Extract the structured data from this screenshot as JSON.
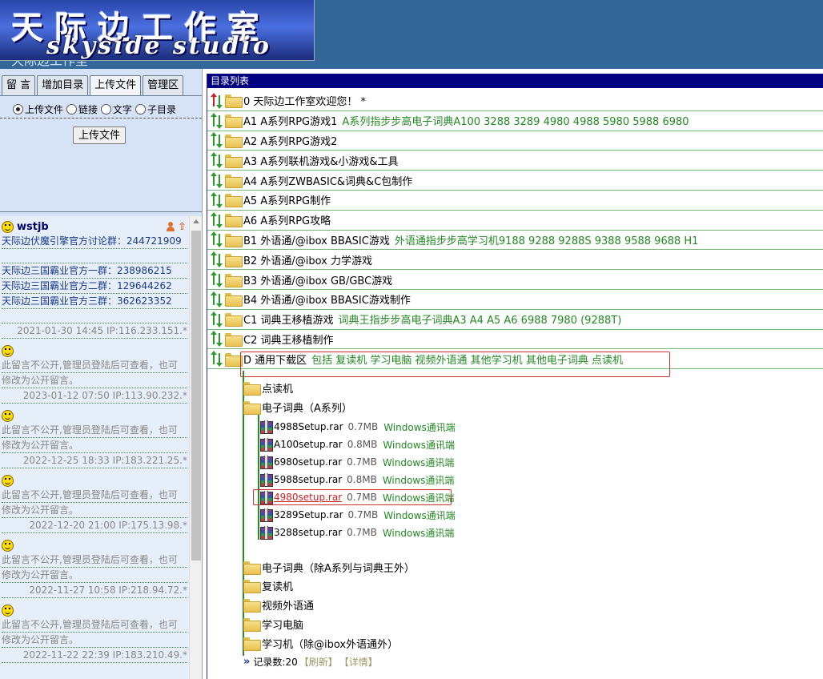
{
  "header": {
    "logo_cn": "天际边工作室",
    "logo_en": "skyside studio",
    "subtitle": "天际边工作室"
  },
  "left": {
    "tabs": [
      "留 言",
      "增加目录",
      "上传文件",
      "管理区"
    ],
    "active_tab": "上传文件",
    "radios": [
      {
        "label": "上传文件",
        "checked": true
      },
      {
        "label": "链接",
        "checked": false
      },
      {
        "label": "文字",
        "checked": false
      },
      {
        "label": "子目录",
        "checked": false
      }
    ],
    "upload_button": "上传文件",
    "guestbook": [
      {
        "user": "wstjb",
        "lines": [
          "天际边伏魔引擎官方讨论群：244721909",
          "",
          "天际边三国霸业官方一群：238986215",
          "天际边三国霸业官方二群：129644262",
          "天际边三国霸业官方三群：362623352",
          ""
        ],
        "meta": "2021-01-30 14:45 IP:116.233.151.*"
      },
      {
        "user": "",
        "lines": [
          "此留言不公开,管理员登陆后可查看，也可",
          "修改为公开留言。"
        ],
        "meta": "2023-01-12 07:50 IP:113.90.232.*"
      },
      {
        "user": "",
        "lines": [
          "此留言不公开,管理员登陆后可查看，也可",
          "修改为公开留言。"
        ],
        "meta": "2022-12-25 18:33 IP:183.221.25.*"
      },
      {
        "user": "",
        "lines": [
          "此留言不公开,管理员登陆后可查看，也可",
          "修改为公开留言。"
        ],
        "meta": "2022-12-20 21:00 IP:175.13.98.*"
      },
      {
        "user": "",
        "lines": [
          "此留言不公开,管理员登陆后可查看，也可",
          "修改为公开留言。"
        ],
        "meta": "2022-11-27 10:58 IP:218.94.72.*"
      },
      {
        "user": "",
        "lines": [
          "此留言不公开,管理员登陆后可查看，也可",
          "修改为公开留言。"
        ],
        "meta": "2022-11-22 22:39 IP:183.210.49.*"
      }
    ]
  },
  "right": {
    "title": "目录列表",
    "rows": [
      {
        "label": "0 天际边工作室欢迎您！ *",
        "desc": "",
        "red": true
      },
      {
        "label": "A1 A系列RPG游戏1",
        "desc": "A系列指步步高电子词典A100 3288 3289 4980 4988 5980 5988 6980",
        "red": false
      },
      {
        "label": "A2 A系列RPG游戏2",
        "desc": "",
        "red": false
      },
      {
        "label": "A3 A系列联机游戏&小游戏&工具",
        "desc": "",
        "red": false
      },
      {
        "label": "A4 A系列ZWBASIC&词典&C包制作",
        "desc": "",
        "red": false
      },
      {
        "label": "A5 A系列RPG制作",
        "desc": "",
        "red": false
      },
      {
        "label": "A6 A系列RPG攻略",
        "desc": "",
        "red": false
      },
      {
        "label": "B1 外语通/@ibox BBASIC游戏",
        "desc": "外语通指步步高学习机9188 9288 9288S 9388 9588 9688 H1",
        "red": false
      },
      {
        "label": "B2 外语通/@ibox 力学游戏",
        "desc": "",
        "red": false
      },
      {
        "label": "B3 外语通/@ibox GB/GBC游戏",
        "desc": "",
        "red": false
      },
      {
        "label": "B4 外语通/@ibox BBASIC游戏制作",
        "desc": "",
        "red": false
      },
      {
        "label": "C1 词典王移植游戏",
        "desc": "词典王指步步高电子词典A3 A4 A5 A6 6988 7980 (9288T)",
        "red": false
      },
      {
        "label": "C2 词典王移植制作",
        "desc": "",
        "red": false
      },
      {
        "label": "D 通用下载区",
        "desc": "包括 复读机 学习电脑 视频外语通 其他学习机 其他电子词典 点读机",
        "red": false
      }
    ],
    "subfolders_top": [
      "点读机",
      "电子词典（A系列）"
    ],
    "files": [
      {
        "name": "4988Setup.rar",
        "size": "0.7MB",
        "tag": "Windows通讯端",
        "link": false
      },
      {
        "name": "A100setup.rar",
        "size": "0.8MB",
        "tag": "Windows通讯端",
        "link": false
      },
      {
        "name": "6980setup.rar",
        "size": "0.7MB",
        "tag": "Windows通讯端",
        "link": false
      },
      {
        "name": "5988setup.rar",
        "size": "0.8MB",
        "tag": "Windows通讯端",
        "link": false
      },
      {
        "name": "4980setup.rar",
        "size": "0.7MB",
        "tag": "Windows通讯端",
        "link": true
      },
      {
        "name": "3289Setup.rar",
        "size": "0.7MB",
        "tag": "Windows通讯端",
        "link": false
      },
      {
        "name": "3288setup.rar",
        "size": "0.7MB",
        "tag": "Windows通讯端",
        "link": false
      }
    ],
    "subfolders_bottom": [
      "电子词典（除A系列与词典王外）",
      "复读机",
      "视频外语通",
      "学习电脑",
      "学习机（除@ibox外语通外）"
    ],
    "footer": {
      "count": "记录数:20",
      "refresh": "【刷新】",
      "detail": "【详情】"
    }
  }
}
